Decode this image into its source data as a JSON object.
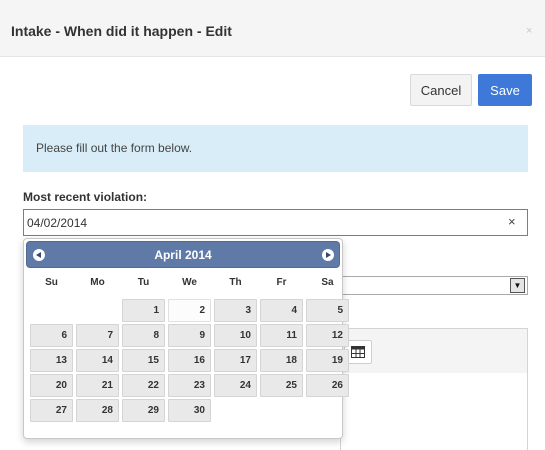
{
  "modal": {
    "title": "Intake - When did it happen - Edit",
    "close_glyph": "×"
  },
  "buttons": {
    "cancel_label": "Cancel",
    "save_label": "Save"
  },
  "notice": "Please fill out the form below.",
  "violation": {
    "label": "Most recent violation:",
    "value": "04/02/2014",
    "clear_glyph": "×"
  },
  "icons": {
    "close": "close-icon",
    "clear": "clear-icon",
    "prev": "prev-month-icon",
    "next": "next-month-icon",
    "dropdown": "chevron-down-icon",
    "table": "table-icon"
  },
  "colors": {
    "save_button": "#3e78d8",
    "notice_bg": "#d8edf7",
    "datepicker_header": "#5f7aa7",
    "input_focus_border": "#4a86d8"
  },
  "datepicker": {
    "month_title": "April 2014",
    "weekdays": [
      "Su",
      "Mo",
      "Tu",
      "We",
      "Th",
      "Fr",
      "Sa"
    ],
    "first_weekday_index": 2,
    "days_in_month": 30,
    "highlighted_day": 2
  }
}
